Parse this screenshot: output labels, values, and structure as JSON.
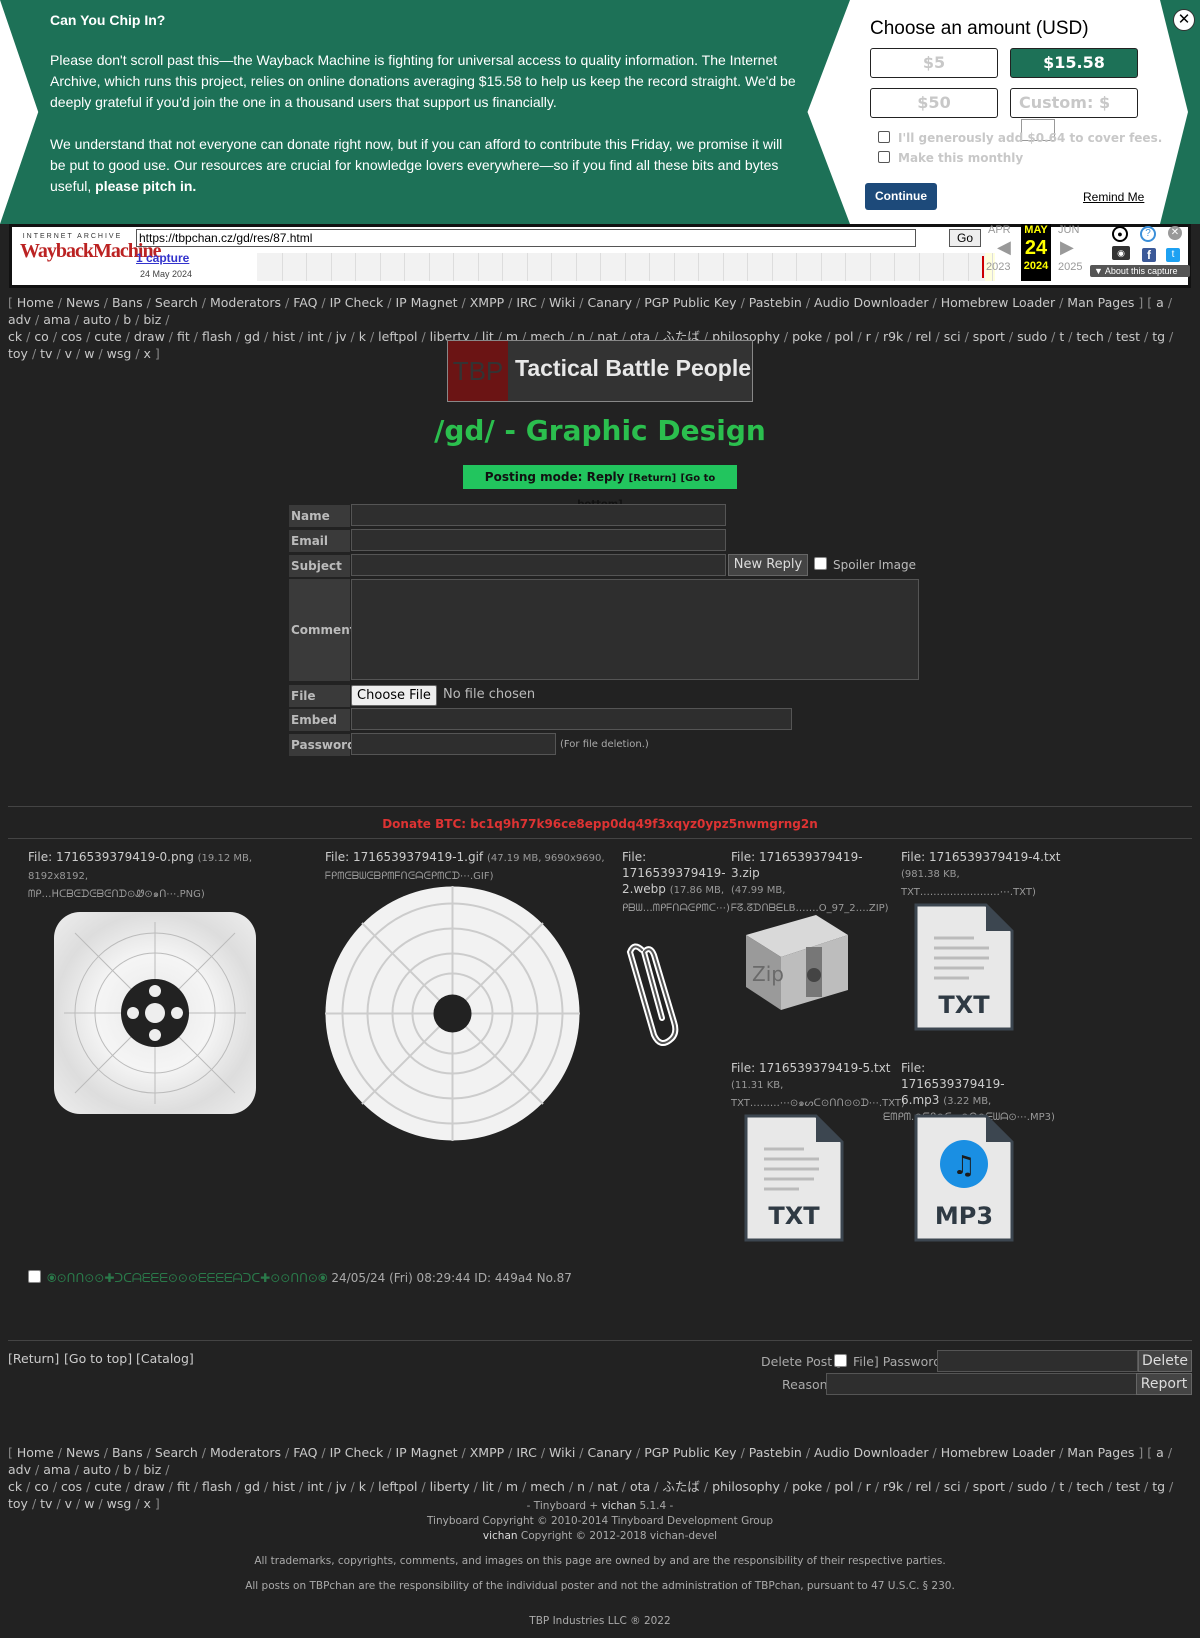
{
  "donation": {
    "heading": "Can You Chip In?",
    "paragraph1": "Please don't scroll past this—the Wayback Machine is fighting for universal access to quality information. The Internet Archive, which runs this project, relies on online donations averaging $15.58 to help us keep the record straight. We'd be deeply grateful if you'd join the one in a thousand users that support us financially.",
    "paragraph2": "We understand that not everyone can donate right now, but if you can afford to contribute this Friday, we promise it will be put to good use. Our resources are crucial for knowledge lovers everywhere—so if you find all these bits and bytes useful,",
    "paragraph2_bold": "please pitch in.",
    "choose_label": "Choose an amount (USD)",
    "amounts": [
      "$5",
      "$15.58",
      "$50"
    ],
    "custom_label": "Custom: $",
    "fee_label": "I'll generously add $0.64 to cover fees.",
    "monthly_label": "Make this monthly",
    "continue_label": "Continue",
    "remind_label": "Remind Me",
    "close_glyph": "✕",
    "accent_color": "#1d7157"
  },
  "wayback": {
    "logo_top": "INTERNET ARCHIVE",
    "logo_main": "WaybackMachine",
    "url": "https://tbpchan.cz/gd/res/87.html",
    "go_label": "Go",
    "captures_label": "1 capture",
    "capture_date": "24 May 2024",
    "prev_month": "APR",
    "cur_month": "MAY",
    "next_month": "JUN",
    "day": "24",
    "prev_year": "2023",
    "cur_year": "2024",
    "next_year": "2025",
    "about_label": "About this capture"
  },
  "boardlist": {
    "row1": [
      "[",
      "Home",
      "/",
      "News",
      "/",
      "Bans",
      "/",
      "Search",
      "/",
      "Moderators",
      "/",
      "FAQ",
      "/",
      "IP Check",
      "/",
      "IP Magnet",
      "/",
      "XMPP",
      "/",
      "IRC",
      "/",
      "Wiki",
      "/",
      "Canary",
      "/",
      "PGP Public Key",
      "/",
      "Pastebin",
      "/",
      "Audio Downloader",
      "/",
      "Homebrew Loader",
      "/",
      "Man Pages",
      "]",
      "[",
      "a",
      "/",
      "adv",
      "/",
      "ama",
      "/",
      "auto",
      "/",
      "b",
      "/",
      "biz",
      "/"
    ],
    "row2": [
      "ck",
      "/",
      "co",
      "/",
      "cos",
      "/",
      "cute",
      "/",
      "draw",
      "/",
      "fit",
      "/",
      "flash",
      "/",
      "gd",
      "/",
      "hist",
      "/",
      "int",
      "/",
      "jv",
      "/",
      "k",
      "/",
      "leftpol",
      "/",
      "liberty",
      "/",
      "lit",
      "/",
      "m",
      "/",
      "mech",
      "/",
      "n",
      "/",
      "nat",
      "/",
      "ota",
      "/",
      "ふたば",
      "/",
      "philosophy",
      "/",
      "poke",
      "/",
      "pol",
      "/",
      "r",
      "/",
      "r9k",
      "/",
      "rel",
      "/",
      "sci",
      "/",
      "sport",
      "/",
      "sudo",
      "/",
      "t",
      "/",
      "tech",
      "/",
      "test",
      "/",
      "tg",
      "/",
      "toy",
      "/",
      "tv",
      "/",
      "v",
      "/",
      "w",
      "/",
      "wsg",
      "/",
      "x",
      "]"
    ]
  },
  "banner": {
    "logo_text": "TBP",
    "name": "Tactical Battle People"
  },
  "board_title": "/gd/ - Graphic Design",
  "posting_mode": {
    "label": "Posting mode: Reply",
    "return": "[Return]",
    "bottom": "[Go to bottom]"
  },
  "form": {
    "name_label": "Name",
    "email_label": "Email",
    "subject_label": "Subject",
    "comment_label": "Comment",
    "file_label": "File",
    "embed_label": "Embed",
    "password_label": "Password",
    "submit_label": "New Reply",
    "spoiler_label": "Spoiler Image",
    "choose_file": "Choose File",
    "no_file": "No file chosen",
    "password_hint": "(For file deletion.)"
  },
  "donate_btc": "Donate BTC: bc1q9h77k96ce8epp0dq49f3xqyz0ypz5nwmgrng2n",
  "files": [
    {
      "label": "File:",
      "name": "1716539379419-0.png",
      "meta": "(19.12 MB, 8192x8192,",
      "meta2": "ᗰᑭ…ᕼᑕᗷᕮᗪᕮᗷᕮᑎᗪ⊙Ꮺ⊙๑ᑎ⋯.PNG)"
    },
    {
      "label": "File:",
      "name": "1716539379419-1.gif",
      "meta": "(47.19 MB, 9690x9690,",
      "meta2": "ᖴᑭᗰᕮᗷᗯᕮᗷᑭᗰᖴᑎᕮᗩᕮᑭᗰᑕᗪ⋯.GIF)"
    },
    {
      "label": "File:",
      "name": "1716539379419-2.webp",
      "meta": "(17.86 MB,",
      "meta2": "ᑭᗷᗯ…ᗰᑭᖴᑎᗩᕮᑭᗰᑕ⋯)"
    },
    {
      "label": "File:",
      "name": "1716539379419-3.zip",
      "meta": "(47.99 MB,",
      "meta2": "ᖴᘔ.ᘔᗪᑎᗷᗴLB…….O_97_2….ZIP)"
    },
    {
      "label": "File:",
      "name": "1716539379419-4.txt",
      "meta": "(981.38 KB,",
      "meta2": "TXT……………………⋯.TXT)"
    },
    {
      "label": "File:",
      "name": "1716539379419-5.txt",
      "meta": "(11.31 KB,",
      "meta2": "TXT………⋯⊙๑ᔕᑕ⊙ᑎᑎ⊙⊙ᗪ⋯.TXT)"
    },
    {
      "label": "File:",
      "name": "1716539379419-6.mp3",
      "meta": "(3.22 MB,",
      "meta2": "ᗴᗰᑭᗰ.⊙ᗴᑭ⊙ᑕᔕ⊙ᗩ⊙ᗴᗯᗩ⊙⋯.MP3)"
    }
  ],
  "doc_labels": {
    "txt": "TXT",
    "mp3": "MP3",
    "zip": "Zip"
  },
  "post": {
    "name": "⦿⊙ᑎᑎ⊙⊙✚ᑐᑕᗩᗴᗴᗴ⊙⊙⊙ᗴᗴᗴᗴᗩᑐᑕ✚⊙⊙ᑎᑎ⊙⦿",
    "datetime": "24/05/24 (Fri) 08:29:44",
    "id": "ID: 449a4",
    "number": "No.87"
  },
  "bottom_nav": {
    "return": "[Return]",
    "top": "[Go to top]",
    "catalog": "[Catalog]"
  },
  "delete_form": {
    "delete_post": "Delete Post [",
    "file": "File] Password",
    "delete_btn": "Delete",
    "reason": "Reason",
    "report_btn": "Report"
  },
  "footer": {
    "line1": "- Tinyboard + ",
    "vichan": "vichan",
    "version": " 5.1.4 -",
    "line2": "Tinyboard Copyright © 2010-2014 Tinyboard Development Group",
    "line3_rest": " Copyright © 2012-2018 vichan-devel",
    "line4": "All trademarks, copyrights, comments, and images on this page are owned by and are the responsibility of their respective parties.",
    "line5": "All posts on TBPchan are the responsibility of the individual poster and not the administration of TBPchan, pursuant to 47 U.S.C. § 230.",
    "line6": "TBP Industries LLC ® 2022"
  }
}
